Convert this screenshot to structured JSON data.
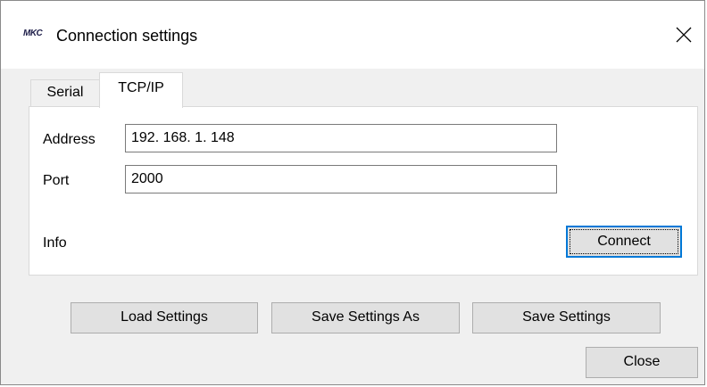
{
  "window": {
    "app_icon_text": "MKC",
    "title": "Connection settings"
  },
  "tabs": [
    {
      "label": "Serial",
      "selected": false
    },
    {
      "label": "TCP/IP",
      "selected": true
    }
  ],
  "tcpip": {
    "address_label": "Address",
    "address_value": "192. 168. 1. 148",
    "port_label": "Port",
    "port_value": "2000",
    "info_label": "Info",
    "connect_label": "Connect"
  },
  "buttons": {
    "load_settings": "Load Settings",
    "save_settings_as": "Save Settings As",
    "save_settings": "Save Settings",
    "close": "Close"
  },
  "colors": {
    "accent": "#0078d7",
    "window_bg": "#f0f0f0",
    "panel_bg": "#ffffff",
    "button_bg": "#e1e1e1"
  }
}
